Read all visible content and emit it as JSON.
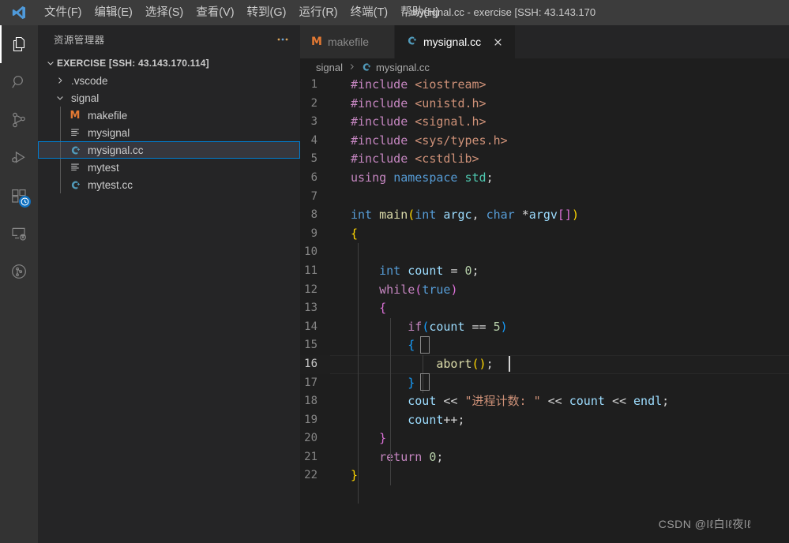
{
  "titlebar": {
    "logo_icon": "vscode-logo",
    "menus": [
      {
        "label": "文件(F)"
      },
      {
        "label": "编辑(E)"
      },
      {
        "label": "选择(S)"
      },
      {
        "label": "查看(V)"
      },
      {
        "label": "转到(G)"
      },
      {
        "label": "运行(R)"
      },
      {
        "label": "终端(T)"
      },
      {
        "label": "帮助(H)"
      }
    ],
    "window_title": "mysignal.cc - exercise [SSH: 43.143.170"
  },
  "activitybar": {
    "items": [
      {
        "name": "explorer",
        "icon": "files-icon",
        "active": true,
        "badge": null
      },
      {
        "name": "search",
        "icon": "search-icon",
        "active": false,
        "badge": null
      },
      {
        "name": "source-control",
        "icon": "source-control-icon",
        "active": false,
        "badge": null
      },
      {
        "name": "run-and-debug",
        "icon": "run-debug-icon",
        "active": false,
        "badge": null
      },
      {
        "name": "extensions",
        "icon": "extensions-icon",
        "active": false,
        "badge": "clock-badge"
      },
      {
        "name": "remote-explorer",
        "icon": "remote-explorer-icon",
        "active": false,
        "badge": null
      },
      {
        "name": "testing",
        "icon": "testing-icon",
        "active": false,
        "badge": null
      }
    ]
  },
  "sidebar": {
    "title": "资源管理器",
    "more_actions_icon": "ellipsis-icon",
    "root": {
      "label": "EXERCISE [SSH: 43.143.170.114]",
      "expanded": true
    },
    "items": [
      {
        "label": ".vscode",
        "type": "folder",
        "expanded": false,
        "depth": 1,
        "icon": "chevron-right-icon",
        "selected": false
      },
      {
        "label": "signal",
        "type": "folder",
        "expanded": true,
        "depth": 1,
        "icon": "chevron-down-icon",
        "selected": false
      },
      {
        "label": "makefile",
        "type": "file",
        "depth": 2,
        "icon": "makefile-icon",
        "selected": false
      },
      {
        "label": "mysignal",
        "type": "file",
        "depth": 2,
        "icon": "binary-icon",
        "selected": false
      },
      {
        "label": "mysignal.cc",
        "type": "file",
        "depth": 2,
        "icon": "cpp-icon",
        "selected": true
      },
      {
        "label": "mytest",
        "type": "file",
        "depth": 2,
        "icon": "binary-icon",
        "selected": false
      },
      {
        "label": "mytest.cc",
        "type": "file",
        "depth": 2,
        "icon": "cpp-icon",
        "selected": false
      }
    ]
  },
  "tabs": [
    {
      "label": "makefile",
      "icon": "makefile-icon",
      "active": false,
      "closable": false
    },
    {
      "label": "mysignal.cc",
      "icon": "cpp-icon",
      "active": true,
      "closable": true,
      "close_icon": "close-icon"
    }
  ],
  "breadcrumbs": [
    {
      "label": "signal",
      "icon": null
    },
    {
      "label": "mysignal.cc",
      "icon": "cpp-icon"
    }
  ],
  "editor": {
    "current_line": 16,
    "lines": [
      {
        "n": "1",
        "tokens": [
          {
            "t": "#include ",
            "c": "t-pre"
          },
          {
            "t": "<iostream>",
            "c": "t-hdr"
          }
        ]
      },
      {
        "n": "2",
        "tokens": [
          {
            "t": "#include ",
            "c": "t-pre"
          },
          {
            "t": "<unistd.h>",
            "c": "t-hdr"
          }
        ]
      },
      {
        "n": "3",
        "tokens": [
          {
            "t": "#include ",
            "c": "t-pre"
          },
          {
            "t": "<signal.h>",
            "c": "t-hdr"
          }
        ]
      },
      {
        "n": "4",
        "tokens": [
          {
            "t": "#include ",
            "c": "t-pre"
          },
          {
            "t": "<sys/types.h>",
            "c": "t-hdr"
          }
        ]
      },
      {
        "n": "5",
        "tokens": [
          {
            "t": "#include ",
            "c": "t-pre"
          },
          {
            "t": "<cstdlib>",
            "c": "t-hdr"
          }
        ]
      },
      {
        "n": "6",
        "tokens": [
          {
            "t": "using ",
            "c": "t-pre"
          },
          {
            "t": "namespace ",
            "c": "t-kw"
          },
          {
            "t": "std",
            "c": "t-type"
          },
          {
            "t": ";",
            "c": "t-op"
          }
        ]
      },
      {
        "n": "7",
        "tokens": []
      },
      {
        "n": "8",
        "tokens": [
          {
            "t": "int ",
            "c": "t-kw"
          },
          {
            "t": "main",
            "c": "t-fn"
          },
          {
            "t": "(",
            "c": "b-y"
          },
          {
            "t": "int ",
            "c": "t-kw"
          },
          {
            "t": "argc",
            "c": "t-var"
          },
          {
            "t": ", ",
            "c": "t-op"
          },
          {
            "t": "char ",
            "c": "t-kw"
          },
          {
            "t": "*",
            "c": "t-op"
          },
          {
            "t": "argv",
            "c": "t-var"
          },
          {
            "t": "[]",
            "c": "b-m"
          },
          {
            "t": ")",
            "c": "b-y"
          }
        ]
      },
      {
        "n": "9",
        "tokens": [
          {
            "t": "{",
            "c": "b-y"
          }
        ]
      },
      {
        "n": "10",
        "tokens": []
      },
      {
        "n": "11",
        "tokens": [
          {
            "t": "    int ",
            "c": "t-kw"
          },
          {
            "t": "count ",
            "c": "t-var"
          },
          {
            "t": "= ",
            "c": "t-op"
          },
          {
            "t": "0",
            "c": "t-num"
          },
          {
            "t": ";",
            "c": "t-op"
          }
        ]
      },
      {
        "n": "12",
        "tokens": [
          {
            "t": "    while",
            "c": "t-pre"
          },
          {
            "t": "(",
            "c": "b-m"
          },
          {
            "t": "true",
            "c": "t-kw"
          },
          {
            "t": ")",
            "c": "b-m"
          }
        ]
      },
      {
        "n": "13",
        "tokens": [
          {
            "t": "    ",
            "c": "t-op"
          },
          {
            "t": "{",
            "c": "b-m"
          }
        ]
      },
      {
        "n": "14",
        "tokens": [
          {
            "t": "        if",
            "c": "t-pre"
          },
          {
            "t": "(",
            "c": "b-b"
          },
          {
            "t": "count ",
            "c": "t-var"
          },
          {
            "t": "== ",
            "c": "t-op"
          },
          {
            "t": "5",
            "c": "t-num"
          },
          {
            "t": ")",
            "c": "b-b"
          }
        ]
      },
      {
        "n": "15",
        "tokens": [
          {
            "t": "        ",
            "c": "t-op"
          },
          {
            "t": "{",
            "c": "b-b"
          }
        ]
      },
      {
        "n": "16",
        "tokens": [
          {
            "t": "            ",
            "c": "t-op"
          },
          {
            "t": "abort",
            "c": "t-fn"
          },
          {
            "t": "()",
            "c": "b-y"
          },
          {
            "t": ";",
            "c": "t-op"
          }
        ]
      },
      {
        "n": "17",
        "tokens": [
          {
            "t": "        ",
            "c": "t-op"
          },
          {
            "t": "}",
            "c": "b-b"
          }
        ]
      },
      {
        "n": "18",
        "tokens": [
          {
            "t": "        ",
            "c": "t-op"
          },
          {
            "t": "cout ",
            "c": "t-var"
          },
          {
            "t": "<< ",
            "c": "t-op"
          },
          {
            "t": "\"进程计数: \"",
            "c": "t-str"
          },
          {
            "t": " << ",
            "c": "t-op"
          },
          {
            "t": "count ",
            "c": "t-var"
          },
          {
            "t": "<< ",
            "c": "t-op"
          },
          {
            "t": "endl",
            "c": "t-var"
          },
          {
            "t": ";",
            "c": "t-op"
          }
        ]
      },
      {
        "n": "19",
        "tokens": [
          {
            "t": "        ",
            "c": "t-op"
          },
          {
            "t": "count",
            "c": "t-var"
          },
          {
            "t": "++;",
            "c": "t-op"
          }
        ]
      },
      {
        "n": "20",
        "tokens": [
          {
            "t": "    ",
            "c": "t-op"
          },
          {
            "t": "}",
            "c": "b-m"
          }
        ]
      },
      {
        "n": "21",
        "tokens": [
          {
            "t": "    return ",
            "c": "t-pre"
          },
          {
            "t": "0",
            "c": "t-num"
          },
          {
            "t": ";",
            "c": "t-op"
          }
        ]
      },
      {
        "n": "22",
        "tokens": [
          {
            "t": "}",
            "c": "b-y"
          }
        ]
      }
    ]
  },
  "watermark": {
    "text": "CSDN @ǀℓ白ǀℓ夜ǀℓ"
  },
  "colors": {
    "accent": "#007fd4",
    "editor_bg": "#1e1e1e",
    "sidebar_bg": "#252526",
    "titlebar_bg": "#3c3c3c",
    "activitybar_bg": "#333333",
    "badge_bg": "#0e70c0",
    "cpp_icon": "#519aba",
    "makefile_icon": "#e37933"
  }
}
